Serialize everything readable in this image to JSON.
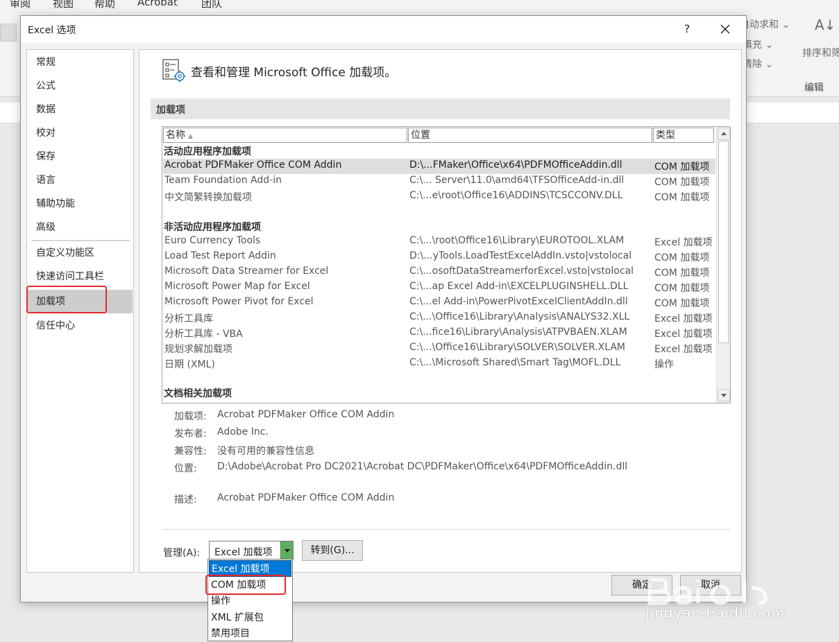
{
  "background": {
    "menu": [
      "审阅",
      "视图",
      "帮助",
      "Acrobat",
      "团队"
    ],
    "ribbon_snippets": [
      "自动求和",
      "填充",
      "清除"
    ],
    "sort_filter": "排序和筛选",
    "group_label": "编辑"
  },
  "dialog": {
    "title": "Excel 选项",
    "help": "?",
    "nav": {
      "items": [
        "常规",
        "公式",
        "数据",
        "校对",
        "保存",
        "语言",
        "辅助功能",
        "高级",
        "自定义功能区",
        "快速访问工具栏",
        "加载项",
        "信任中心"
      ],
      "selected": "加载项"
    },
    "header": "查看和管理 Microsoft Office 加载项。",
    "section_label": "加载项",
    "table": {
      "columns": [
        "名称",
        "位置",
        "类型"
      ],
      "groups": [
        {
          "title": "活动应用程序加载项",
          "rows": [
            {
              "name": "Acrobat PDFMaker Office COM Addin",
              "location": "D:\\...FMaker\\Office\\x64\\PDFMOfficeAddin.dll",
              "type": "COM 加载项",
              "selected": true
            },
            {
              "name": "Team Foundation Add-in",
              "location": "C:\\... Server\\11.0\\amd64\\TFSOfficeAdd-in.dll",
              "type": "COM 加载项"
            },
            {
              "name": "中文简繁转换加载项",
              "location": "C:\\...e\\root\\Office16\\ADDINS\\TCSCCONV.DLL",
              "type": "COM 加载项"
            }
          ]
        },
        {
          "title": "非活动应用程序加载项",
          "rows": [
            {
              "name": "Euro Currency Tools",
              "location": "C:\\...\\root\\Office16\\Library\\EUROTOOL.XLAM",
              "type": "Excel 加载项"
            },
            {
              "name": "Load Test Report Addin",
              "location": "D:\\...yTools.LoadTestExcelAddIn.vsto|vstolocal",
              "type": "COM 加载项"
            },
            {
              "name": "Microsoft Data Streamer for Excel",
              "location": "C:\\...osoftDataStreamerforExcel.vsto|vstolocal",
              "type": "COM 加载项"
            },
            {
              "name": "Microsoft Power Map for Excel",
              "location": "C:\\...ap Excel Add-in\\EXCELPLUGINSHELL.DLL",
              "type": "COM 加载项"
            },
            {
              "name": "Microsoft Power Pivot for Excel",
              "location": "C:\\...el Add-in\\PowerPivotExcelClientAddIn.dll",
              "type": "COM 加载项"
            },
            {
              "name": "分析工具库",
              "location": "C:\\...\\Office16\\Library\\Analysis\\ANALYS32.XLL",
              "type": "Excel 加载项"
            },
            {
              "name": "分析工具库 - VBA",
              "location": "C:\\...fice16\\Library\\Analysis\\ATPVBAEN.XLAM",
              "type": "Excel 加载项"
            },
            {
              "name": "规划求解加载项",
              "location": "C:\\...\\Office16\\Library\\SOLVER\\SOLVER.XLAM",
              "type": "Excel 加载项"
            },
            {
              "name": "日期 (XML)",
              "location": "C:\\...\\Microsoft Shared\\Smart Tag\\MOFL.DLL",
              "type": "操作"
            }
          ]
        },
        {
          "title": "文档相关加载项",
          "rows": []
        }
      ]
    },
    "details": [
      {
        "label": "加载项:",
        "value": "Acrobat PDFMaker Office COM Addin"
      },
      {
        "label": "发布者:",
        "value": "Adobe Inc."
      },
      {
        "label": "兼容性:",
        "value": "没有可用的兼容性信息"
      },
      {
        "label": "位置:",
        "value": "D:\\Adobe\\Acrobat Pro DC2021\\Acrobat DC\\PDFMaker\\Office\\x64\\PDFMOfficeAddin.dll"
      },
      {
        "label": "描述:",
        "value": "Acrobat PDFMaker Office COM Addin"
      }
    ],
    "manage_label": "管理(A):",
    "manage_value": "Excel 加载项",
    "goto_label": "转到(G)...",
    "ok_label": "确定",
    "cancel_label": "取消",
    "dropdown_options": [
      "Excel 加载项",
      "COM 加载项",
      "操作",
      "XML 扩展包",
      "禁用项目"
    ],
    "dropdown_selected": "Excel 加载项"
  },
  "watermark": {
    "text": "jingyan.baidu.com"
  },
  "colors": {
    "highlight": "#e8262a",
    "selection": "#0078d7"
  }
}
